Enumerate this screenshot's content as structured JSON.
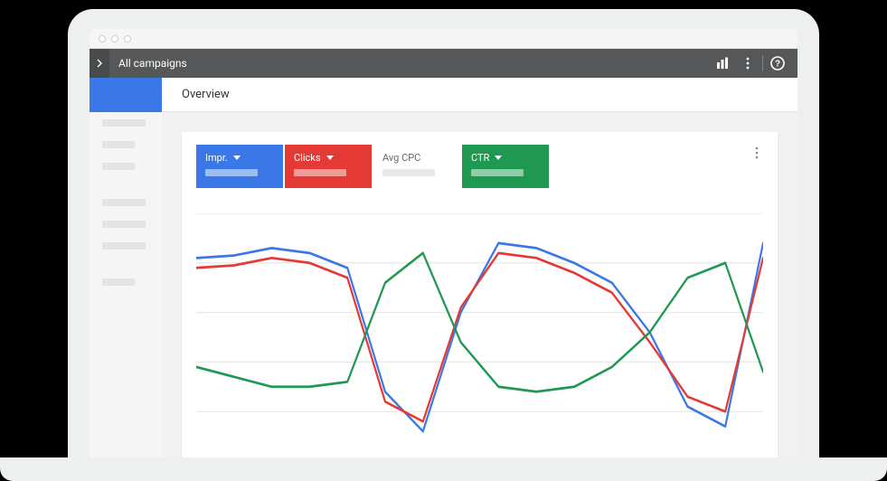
{
  "topbar": {
    "title": "All campaigns"
  },
  "subheader": {
    "title": "Overview"
  },
  "metrics": [
    {
      "label": "Impr.",
      "color": "blue",
      "interactive": true
    },
    {
      "label": "Clicks",
      "color": "red",
      "interactive": true
    },
    {
      "label": "Avg CPC",
      "color": "white",
      "interactive": false
    },
    {
      "label": "CTR",
      "color": "green",
      "interactive": true
    }
  ],
  "colors": {
    "blue": "#3b78e7",
    "red": "#e53935",
    "green": "#1f9851",
    "white": "#ffffff",
    "inactive_text": "#666666"
  },
  "chart_data": {
    "type": "line",
    "x": [
      0,
      1,
      2,
      3,
      4,
      5,
      6,
      7,
      8,
      9,
      10,
      11,
      12,
      13,
      14,
      15
    ],
    "ylim": [
      0,
      100
    ],
    "grid_y": [
      0,
      20,
      40,
      60,
      80,
      100
    ],
    "series": [
      {
        "name": "Impr.",
        "color": "blue",
        "values": [
          82,
          83,
          86,
          84,
          78,
          28,
          12,
          60,
          88,
          86,
          80,
          72,
          52,
          22,
          14,
          88
        ]
      },
      {
        "name": "Clicks",
        "color": "red",
        "values": [
          78,
          79,
          82,
          80,
          74,
          24,
          16,
          62,
          84,
          82,
          76,
          68,
          48,
          26,
          20,
          82
        ]
      },
      {
        "name": "CTR",
        "color": "green",
        "values": [
          38,
          34,
          30,
          30,
          32,
          72,
          84,
          48,
          30,
          28,
          30,
          38,
          52,
          74,
          80,
          36
        ]
      }
    ]
  }
}
